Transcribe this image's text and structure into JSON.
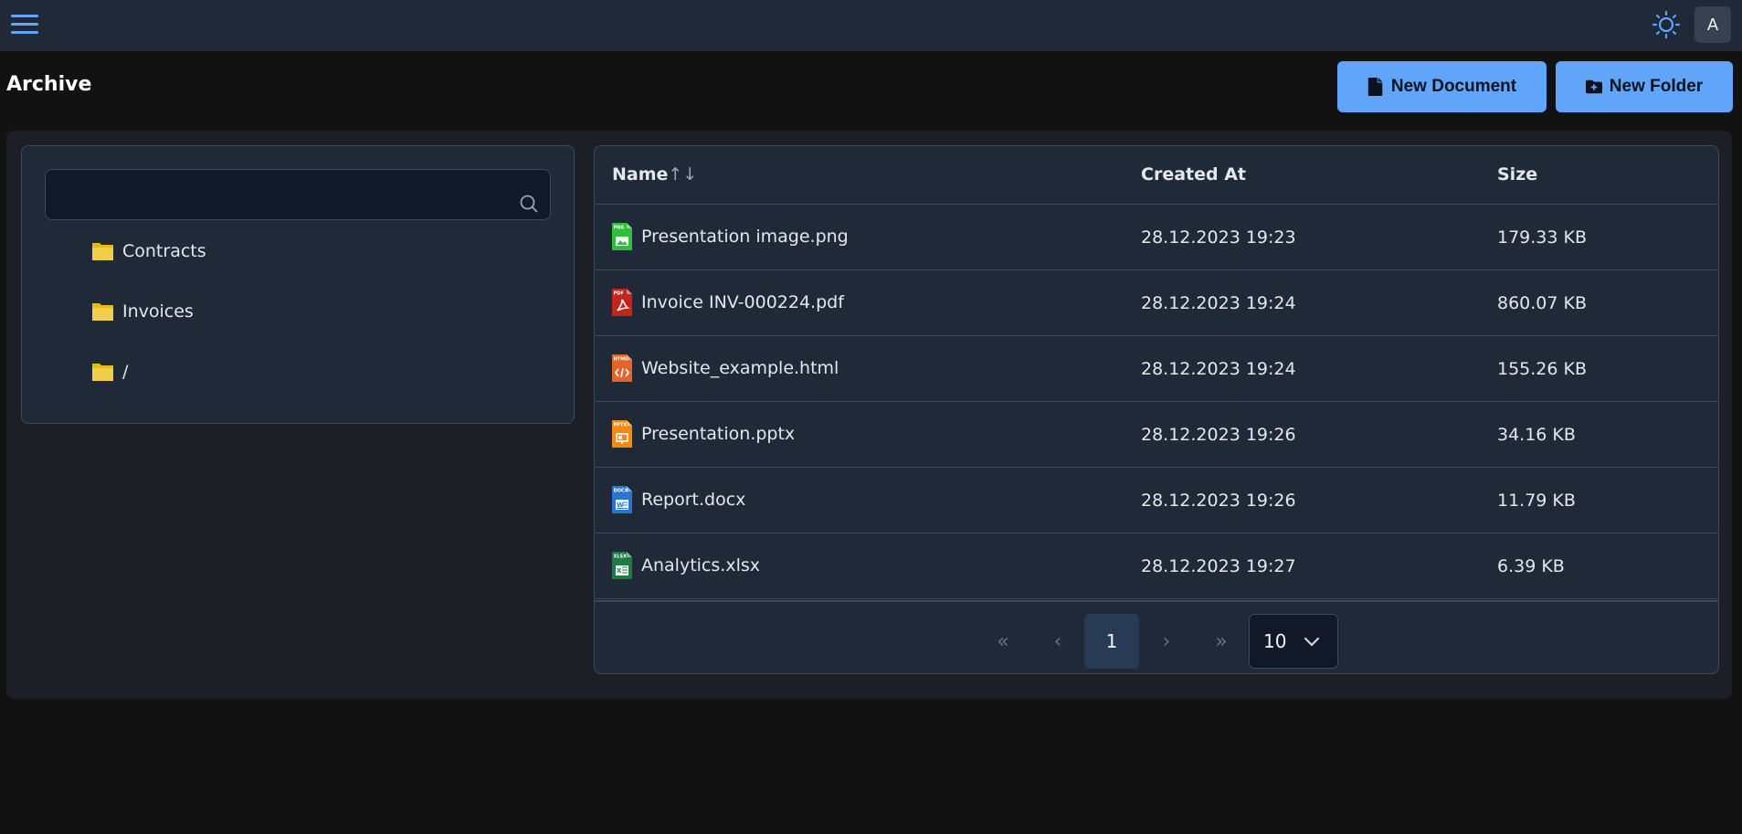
{
  "topbar": {
    "menu_icon": "hamburger-menu-icon",
    "theme_icon": "sun-icon",
    "avatar_initial": "A"
  },
  "header": {
    "title": "Archive",
    "new_document_label": "New Document",
    "new_folder_label": "New Folder"
  },
  "colors": {
    "accent": "#60a5fa",
    "topbar_bg": "#1f2937",
    "card_bg": "#1f2937",
    "page_bg": "#121212",
    "folder": "#f0d04a"
  },
  "tree": {
    "search_value": "",
    "search_placeholder": "",
    "folders": [
      {
        "label": "Contracts"
      },
      {
        "label": "Invoices"
      },
      {
        "label": "/"
      }
    ]
  },
  "table": {
    "columns": {
      "name": "Name",
      "sort_indicator": "↑↓",
      "created": "Created At",
      "size": "Size"
    },
    "rows": [
      {
        "name": "Presentation image.png",
        "type": "png",
        "created": "28.12.2023 19:23",
        "size": "179.33 KB"
      },
      {
        "name": "Invoice INV-000224.pdf",
        "type": "pdf",
        "created": "28.12.2023 19:24",
        "size": "860.07 KB"
      },
      {
        "name": "Website_example.html",
        "type": "html",
        "created": "28.12.2023 19:24",
        "size": "155.26 KB"
      },
      {
        "name": "Presentation.pptx",
        "type": "pptx",
        "created": "28.12.2023 19:26",
        "size": "34.16 KB"
      },
      {
        "name": "Report.docx",
        "type": "docx",
        "created": "28.12.2023 19:26",
        "size": "11.79 KB"
      },
      {
        "name": "Analytics.xlsx",
        "type": "xlsx",
        "created": "28.12.2023 19:27",
        "size": "6.39 KB"
      }
    ],
    "file_icon_colors": {
      "png": "#2fbf3a",
      "pdf": "#c4251b",
      "html": "#e2652b",
      "pptx": "#f08a12",
      "docx": "#2b74d0",
      "xlsx": "#1f7a43"
    }
  },
  "pagination": {
    "first": "«",
    "prev": "‹",
    "current_page": "1",
    "next": "›",
    "last": "»",
    "per_page": "10"
  }
}
